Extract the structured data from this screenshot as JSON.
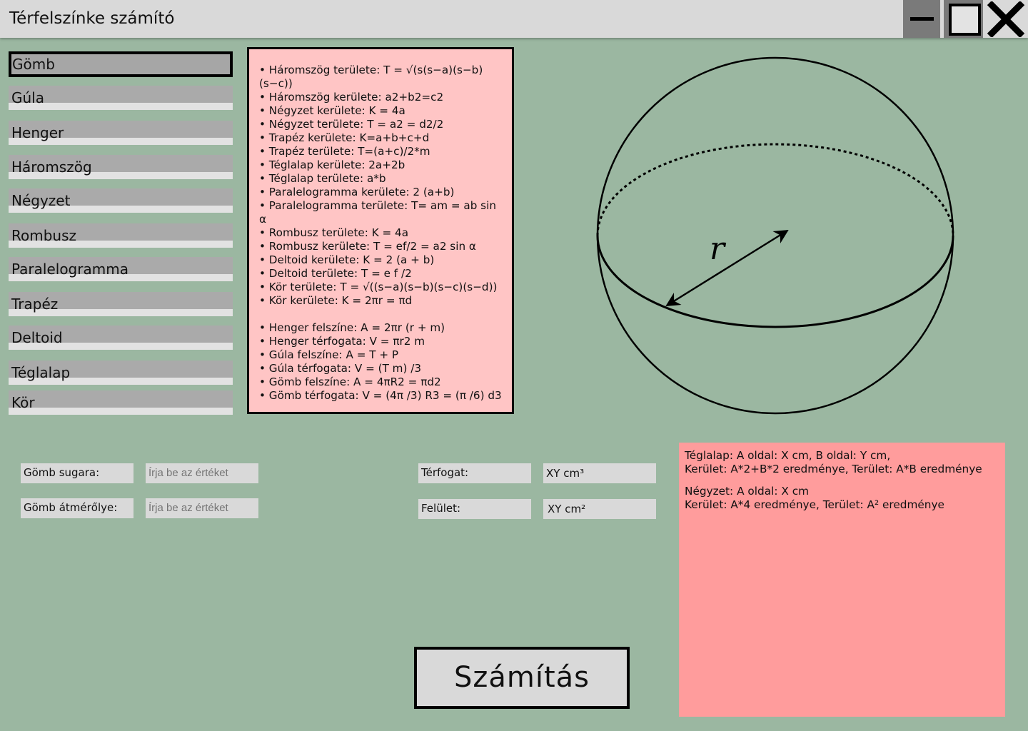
{
  "window": {
    "title": "Térfelszínke számító",
    "minimize_icon": "minimize-icon",
    "maximize_icon": "maximize-icon",
    "close_icon": "close-icon"
  },
  "menu": {
    "items": [
      {
        "label": "Gömb",
        "selected": true
      },
      {
        "label": "Gúla"
      },
      {
        "label": "Henger"
      },
      {
        "label": "Háromszög"
      },
      {
        "label": "Négyzet"
      },
      {
        "label": "Rombusz"
      },
      {
        "label": "Paralelogramma"
      },
      {
        "label": "Trapéz"
      },
      {
        "label": "Deltoid"
      },
      {
        "label": "Téglalap"
      },
      {
        "label": "Kör"
      }
    ]
  },
  "formulas": {
    "plane": [
      "Háromszög területe: T = √(s(s−a)(s−b)(s−c))",
      "Háromszög kerülete: a2+b2=c2",
      "Négyzet kerülete: K = 4a",
      "Négyzet területe: T = a2 = d2/2",
      "Trapéz kerülete: K=a+b+c+d",
      "Trapéz területe: T=(a+c)/2*m",
      "Téglalap kerülete: 2a+2b",
      "Téglalap területe: a*b",
      "Paralelogramma kerülete: 2 (a+b)",
      "Paralelogramma területe: T= am = ab sin α",
      "Rombusz területe: K = 4a",
      "Rombusz kerülete: T = ef/2 = a2 sin α",
      "Deltoid kerülete: K = 2 (a + b)",
      "Deltoid területe: T = e f /2",
      "Kör területe: T = √((s−a)(s−b)(s−c)(s−d))",
      "Kör kerülete: K = 2πr = πd"
    ],
    "solid": [
      "Henger felszíne: A = 2πr (r + m)",
      "Henger térfogata: V = πr2 m",
      "Gúla felszíne: A = T + P",
      "Gúla térfogata: V = (T m) /3",
      "Gömb felszíne: A = 4πR2 = πd2",
      "Gömb térfogata: V = (4π /3) R3 = (π /6) d3"
    ]
  },
  "diagram": {
    "radius_label": "r"
  },
  "inputs": {
    "radius_label": "Gömb sugara:",
    "radius_placeholder": "Írja be az értéket",
    "diameter_label": "Gömb átmérőlye:",
    "diameter_placeholder": "Írja be az értéket"
  },
  "outputs": {
    "volume_label": "Térfogat:",
    "volume_value": "XY cm³",
    "surface_label": "Felület:",
    "surface_value": "XY cm²"
  },
  "info": {
    "rect_text": "Téglalap: A oldal: X cm, B oldal: Y cm,\nKerület: A*2+B*2 eredménye, Terület: A*B eredménye",
    "square_text": "Négyzet: A oldal: X cm\nKerület: A*4 eredménye, Terület: A² eredménye"
  },
  "actions": {
    "calculate_label": "Számítás"
  },
  "colors": {
    "background": "#9bb7a1",
    "formula_box": "#ffc5c5",
    "info_box": "#ff9c9c",
    "menu_item": "#aaaaaa",
    "titlebar": "#d9d9d9"
  }
}
